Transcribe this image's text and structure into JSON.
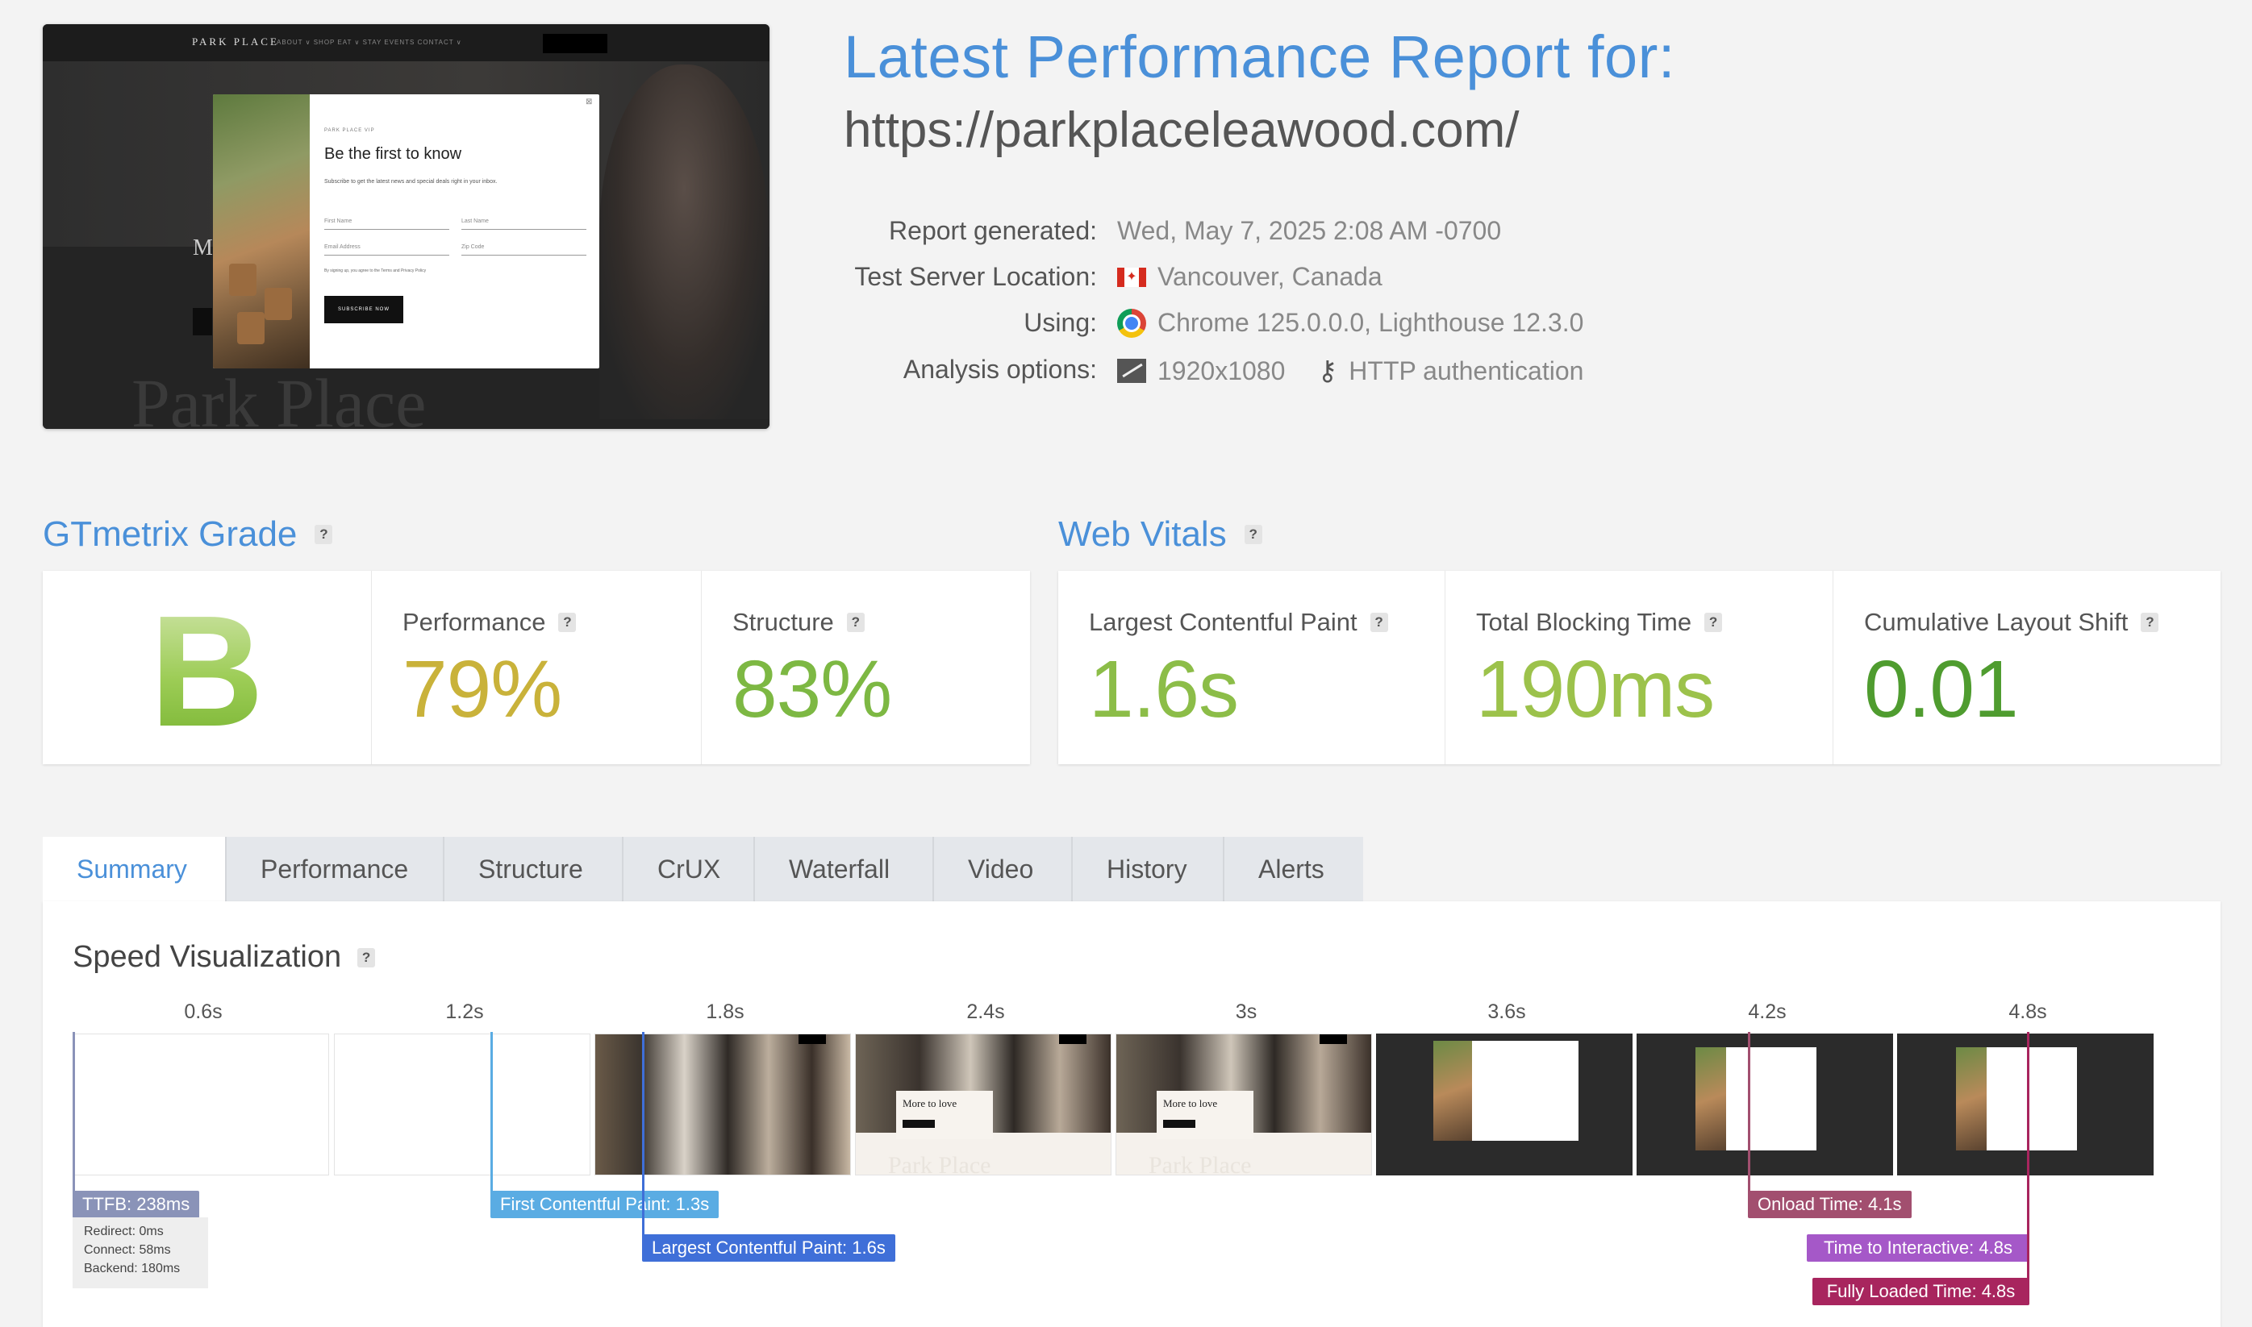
{
  "header": {
    "title": "Latest Performance Report for:",
    "url": "https://parkplaceleawood.com/",
    "meta": [
      {
        "label": "Report generated:",
        "value": "Wed, May 7, 2025 2:08 AM -0700"
      },
      {
        "label": "Test Server Location:",
        "value": "Vancouver, Canada",
        "icon": "canada-flag-icon"
      },
      {
        "label": "Using:",
        "value": "Chrome 125.0.0.0, Lighthouse 12.3.0",
        "icon": "chrome-icon"
      },
      {
        "label": "Analysis options:",
        "value": "1920x1080",
        "value2": "HTTP authentication",
        "icon": "resolution-icon",
        "icon2": "key-icon"
      }
    ]
  },
  "screenshot": {
    "brand": "PARK PLACE",
    "nav": "ABOUT ∨   SHOP   EAT ∨   STAY   EVENTS   CONTACT ∨",
    "popup_label": "PARK PLACE VIP",
    "popup_title": "Be the first to know",
    "popup_sub": "Subscribe to get the latest news and special deals right in your inbox.",
    "first_name": "First Name",
    "last_name": "Last Name",
    "email": "Email Address",
    "zip": "Zip Code",
    "consent": "By signing up, you agree to the Terms and Privacy Policy",
    "subscribe": "SUBSCRIBE NOW",
    "close": "⊠",
    "hero_letter": "M",
    "watermark": "Park Place"
  },
  "grade": {
    "title": "GTmetrix Grade",
    "letter": "B",
    "performance_label": "Performance",
    "performance_value": "79%",
    "structure_label": "Structure",
    "structure_value": "83%"
  },
  "vitals": {
    "title": "Web Vitals",
    "lcp_label": "Largest Contentful Paint",
    "lcp_value": "1.6s",
    "tbt_label": "Total Blocking Time",
    "tbt_value": "190ms",
    "cls_label": "Cumulative Layout Shift",
    "cls_value": "0.01"
  },
  "colors": {
    "accent": "#4a90d9",
    "grade_green": "#7ab43a",
    "performance": "#c9b23a",
    "structure": "#7db843",
    "lcp": "#8cbd48",
    "tbt": "#9cc24b",
    "cls": "#4f9c2f"
  },
  "tabs": [
    "Summary",
    "Performance",
    "Structure",
    "CrUX",
    "Waterfall",
    "Video",
    "History",
    "Alerts"
  ],
  "active_tab": "Summary",
  "speed": {
    "title": "Speed Visualization",
    "frames": [
      "0.6s",
      "1.2s",
      "1.8s",
      "2.4s",
      "3s",
      "3.6s",
      "4.2s",
      "4.8s"
    ],
    "frame_words": [
      "More to love",
      "More to love"
    ],
    "frame_watermark": "Park Place",
    "markers": {
      "ttfb": "TTFB: 238ms",
      "fcp": "First Contentful Paint: 1.3s",
      "lcp": "Largest Contentful Paint: 1.6s",
      "onload": "Onload Time: 4.1s",
      "tti": "Time to Interactive: 4.8s",
      "fully_loaded": "Fully Loaded Time: 4.8s"
    },
    "marker_colors": {
      "ttfb": "#8a93b8",
      "fcp": "#5aace3",
      "lcp": "#3f6fd8",
      "onload": "#a24f6f",
      "tti": "#a558c8",
      "fully_loaded": "#a8255e"
    },
    "ttfb_detail": [
      "Redirect: 0ms",
      "Connect: 58ms",
      "Backend: 180ms"
    ]
  }
}
